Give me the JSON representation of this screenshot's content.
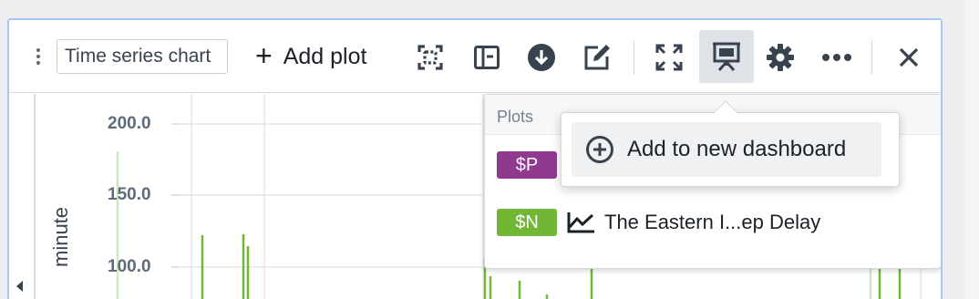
{
  "toolbar": {
    "title_value": "Time series chart",
    "add_plot_label": "Add plot",
    "buttons": [
      "focus-icon",
      "layout-icon",
      "download-icon",
      "edit-icon",
      "fullscreen-icon",
      "presentation-icon",
      "gear-icon",
      "more-icon",
      "close-icon"
    ]
  },
  "chart": {
    "y_axis_label": "minute",
    "y_ticks": [
      "200.0",
      "150.0",
      "100.0"
    ],
    "line_color": "#72b635"
  },
  "plots_panel": {
    "header": "Plots",
    "items": [
      {
        "badge": "$P",
        "badge_color": "#8f398f",
        "name": ""
      },
      {
        "badge": "$N",
        "badge_color": "#72b635",
        "name": "The Eastern I...ep Delay"
      }
    ]
  },
  "menu": {
    "item_label": "Add to new dashboard"
  }
}
